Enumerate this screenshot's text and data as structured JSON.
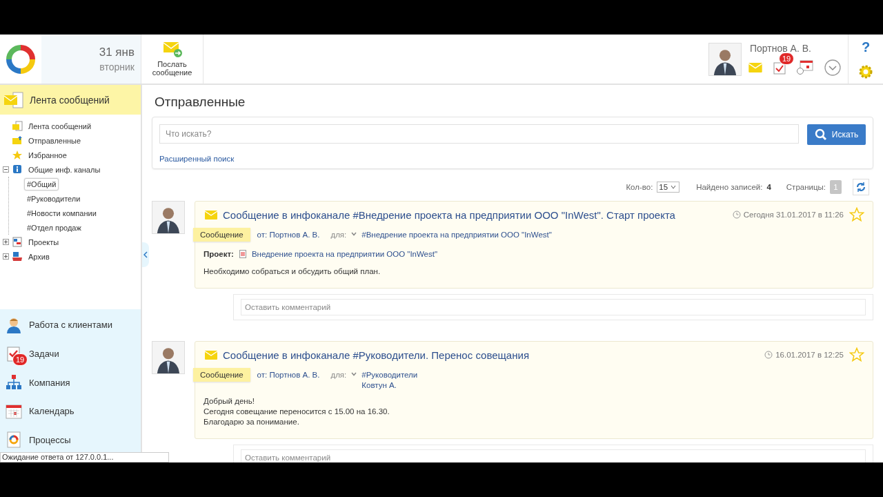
{
  "header": {
    "date_day": "31 янв",
    "date_weekday": "вторник",
    "send_button": "Послать сообщение",
    "user_name": "Портнов А. В.",
    "tasks_badge": "19",
    "help": "?"
  },
  "sidebar": {
    "section_title": "Лента сообщений",
    "tree": [
      {
        "label": "Лента сообщений",
        "kind": "feed",
        "selected": false
      },
      {
        "label": "Отправленные",
        "kind": "sent",
        "selected": false
      },
      {
        "label": "Избранное",
        "kind": "star",
        "selected": false
      },
      {
        "label": "Общие инф. каналы",
        "kind": "info",
        "expanded": true,
        "selected": false,
        "children": [
          {
            "label": "#Общий",
            "selected": true
          },
          {
            "label": "#Руководители",
            "selected": false
          },
          {
            "label": "#Новости компании",
            "selected": false
          },
          {
            "label": "#Отдел продаж",
            "selected": false
          }
        ]
      },
      {
        "label": "Проекты",
        "kind": "projects",
        "expanded": false,
        "selected": false
      },
      {
        "label": "Архив",
        "kind": "archive",
        "expanded": false,
        "selected": false
      }
    ],
    "nav": [
      {
        "label": "Работа с клиентами",
        "kind": "clients"
      },
      {
        "label": "Задачи",
        "kind": "tasks",
        "badge": "19"
      },
      {
        "label": "Компания",
        "kind": "company"
      },
      {
        "label": "Календарь",
        "kind": "calendar"
      },
      {
        "label": "Процессы",
        "kind": "processes"
      }
    ]
  },
  "main": {
    "title": "Отправленные",
    "search": {
      "placeholder": "Что искать?",
      "button": "Искать",
      "advanced_link": "Расширенный поиск"
    },
    "toolbar": {
      "count_label": "Кол-во:",
      "count_value": "15",
      "found_label": "Найдено записей:",
      "found_value": "4",
      "pages_label": "Страницы:",
      "pages": [
        {
          "label": "1",
          "selected": true
        }
      ]
    },
    "messages": [
      {
        "title": "Сообщение в инфоканале #Внедрение проекта на предприятии ООО \"InWest\". Старт проекта",
        "time": "Сегодня 31.01.2017 в 11:26",
        "starred": false,
        "tag": "Сообщение",
        "from": "от: Портнов А. В.",
        "to_label": "для:",
        "recipients": [
          "#Внедрение проекта на предприятии ООО \"InWest\""
        ],
        "project_label": "Проект:",
        "project": "Внедрение проекта на предприятии ООО \"InWest\"",
        "body": [
          "Необходимо собраться и обсудить общий план."
        ],
        "comment_placeholder": "Оставить комментарий"
      },
      {
        "title": "Сообщение в инфоканале #Руководители. Перенос совещания",
        "time": "16.01.2017 в 12:25",
        "starred": false,
        "tag": "Сообщение",
        "from": "от: Портнов А. В.",
        "to_label": "для:",
        "recipients": [
          "#Руководители",
          "Ковтун А."
        ],
        "body": [
          "Добрый день!",
          "Сегодня совещание переносится с 15.00 на 16.30.",
          "Благодарю за понимание."
        ],
        "comment_placeholder": "Оставить комментарий"
      }
    ]
  },
  "status_bar": "Ожидание ответа от 127.0.0.1..."
}
